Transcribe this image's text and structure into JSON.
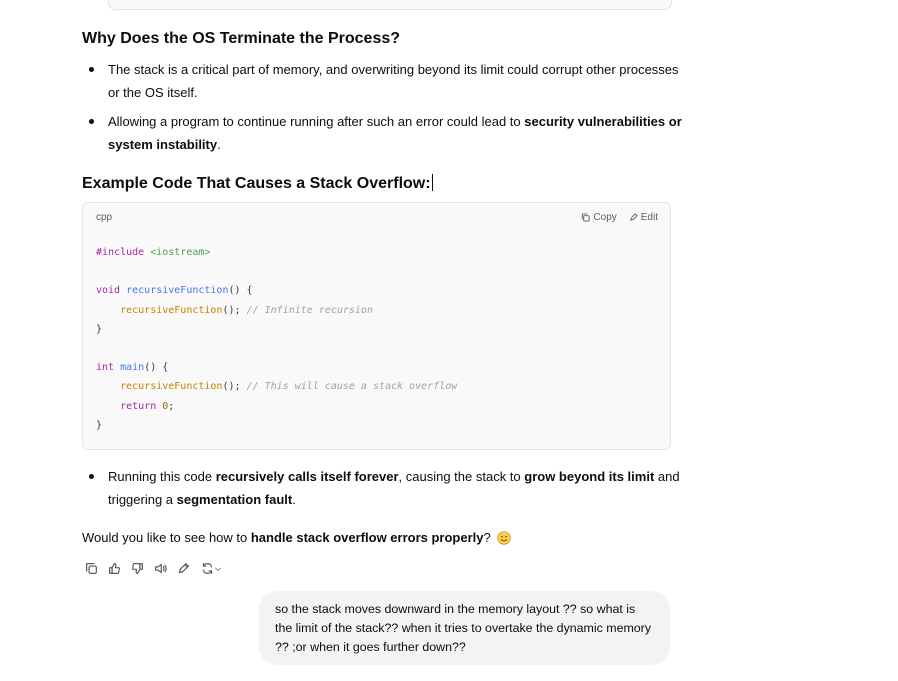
{
  "section_why": {
    "heading": "Why Does the OS Terminate the Process?",
    "bullets": [
      {
        "text_1": "The stack is a critical part of memory, and overwriting beyond its limit could corrupt other processes or the OS itself."
      },
      {
        "text_1": "Allowing a program to continue running after such an error could lead to ",
        "bold_1": "security vulnerabilities or system instability",
        "text_2": "."
      }
    ]
  },
  "section_example": {
    "heading": "Example Code That Causes a Stack Overflow:"
  },
  "code_block": {
    "language": "cpp",
    "copy_label": "Copy",
    "edit_label": "Edit",
    "tokens": {
      "include": "#include",
      "iostream": "<iostream>",
      "void_kw": "void",
      "fn_name": "recursiveFunction",
      "fn_sig_tail": "() {",
      "call_1": "recursiveFunction",
      "call_1_tail": "();",
      "comment_1": "// Infinite recursion",
      "close_1": "}",
      "int_kw": "int",
      "main_name": "main",
      "main_tail": "() {",
      "call_2": "recursiveFunction",
      "call_2_tail": "();",
      "comment_2": "// This will cause a stack overflow",
      "return_kw": "return",
      "zero": "0",
      "semi": ";",
      "close_2": "}"
    }
  },
  "run_bullet": {
    "text_1": "Running this code ",
    "bold_1": "recursively calls itself forever",
    "text_2": ", causing the stack to ",
    "bold_2": "grow beyond its limit",
    "text_3": " and triggering a ",
    "bold_3": "segmentation fault",
    "text_4": "."
  },
  "followup": {
    "text_1": "Would you like to see how to ",
    "bold_1": "handle stack overflow errors properly",
    "text_2": "?",
    "emoji": "smiling-face-emoji"
  },
  "action_bar": {
    "icons": [
      "copy-icon",
      "thumbs-up-icon",
      "thumbs-down-icon",
      "read-aloud-icon",
      "edit-canvas-icon",
      "regenerate-icon",
      "chevron-down-icon"
    ]
  },
  "user_message": {
    "text": "so the stack moves downward in the memory layout ?? so what is the limit of the stack?? when it tries to overtake the dynamic memory ?? ;or when it goes further down??"
  },
  "colors": {
    "keyword": "#a626a4",
    "string": "#50a14f",
    "function": "#4078f2",
    "call": "#c18401",
    "comment": "#a0a1a7",
    "number": "#986801",
    "bubble_bg": "#f3f3f3",
    "code_bg": "#f9f9f9"
  }
}
